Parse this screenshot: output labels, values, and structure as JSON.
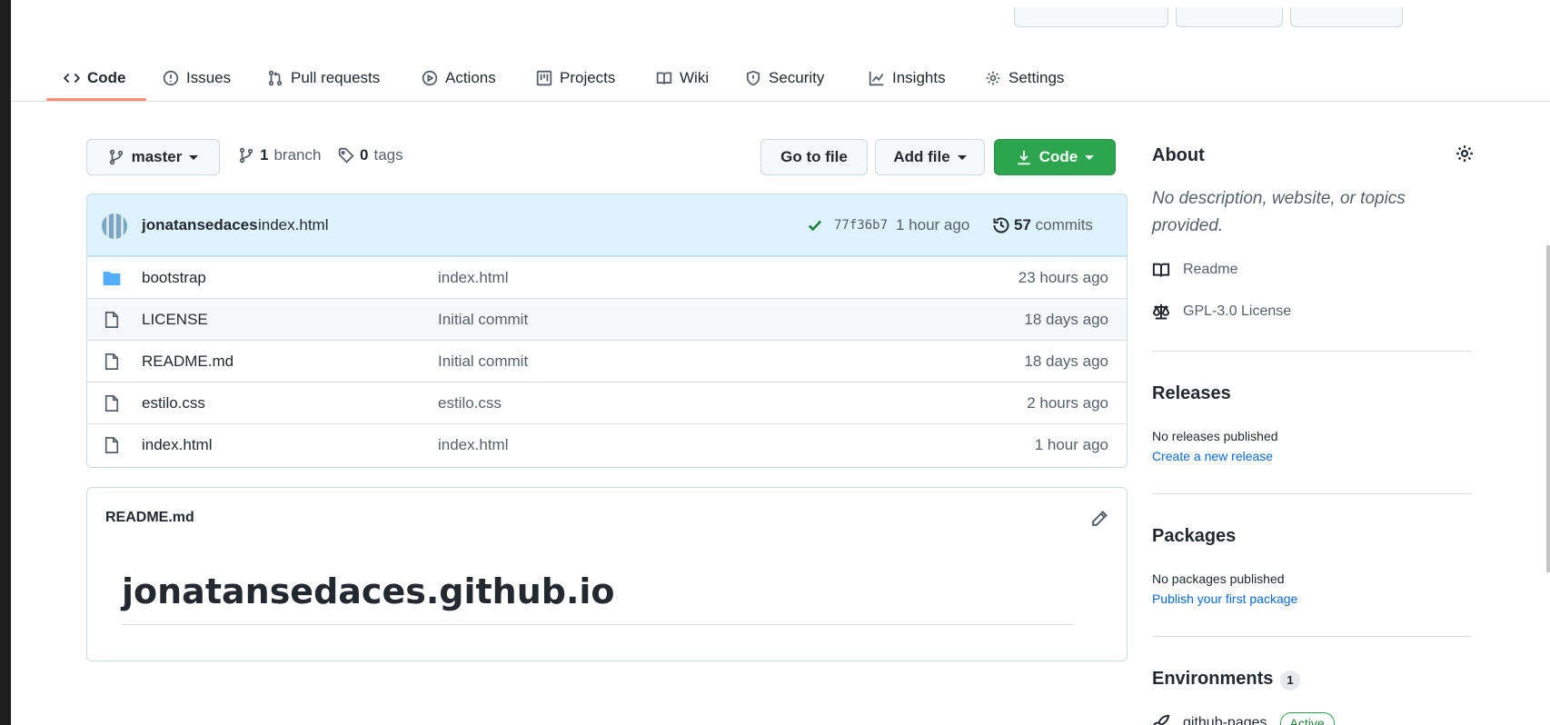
{
  "nav": {
    "tabs": [
      {
        "label": "Code",
        "icon": "code-icon"
      },
      {
        "label": "Issues",
        "icon": "issue-icon"
      },
      {
        "label": "Pull requests",
        "icon": "pull-request-icon"
      },
      {
        "label": "Actions",
        "icon": "play-icon"
      },
      {
        "label": "Projects",
        "icon": "project-icon"
      },
      {
        "label": "Wiki",
        "icon": "book-icon"
      },
      {
        "label": "Security",
        "icon": "shield-icon"
      },
      {
        "label": "Insights",
        "icon": "graph-icon"
      },
      {
        "label": "Settings",
        "icon": "gear-icon"
      }
    ],
    "active_tab": "Code"
  },
  "branch_bar": {
    "branch_name": "master",
    "branches_count": "1",
    "branches_label": "branch",
    "tags_count": "0",
    "tags_label": "tags",
    "go_to_file": "Go to file",
    "add_file": "Add file",
    "code_button": "Code"
  },
  "commit": {
    "author": "jonatansedaces",
    "message": "index.html",
    "sha": "77f36b7",
    "time": "1 hour ago",
    "commits_count": "57",
    "commits_label": "commits"
  },
  "files": [
    {
      "name": "bootstrap",
      "type": "folder",
      "message": "index.html",
      "age": "23 hours ago"
    },
    {
      "name": "LICENSE",
      "type": "file",
      "message": "Initial commit",
      "age": "18 days ago"
    },
    {
      "name": "README.md",
      "type": "file",
      "message": "Initial commit",
      "age": "18 days ago"
    },
    {
      "name": "estilo.css",
      "type": "file",
      "message": "estilo.css",
      "age": "2 hours ago"
    },
    {
      "name": "index.html",
      "type": "file",
      "message": "index.html",
      "age": "1 hour ago"
    }
  ],
  "readme": {
    "filename": "README.md",
    "heading": "jonatansedaces.github.io"
  },
  "sidebar": {
    "about": {
      "title": "About",
      "description": "No description, website, or topics provided.",
      "readme_label": "Readme",
      "license_label": "GPL-3.0 License"
    },
    "releases": {
      "title": "Releases",
      "status": "No releases published",
      "link": "Create a new release"
    },
    "packages": {
      "title": "Packages",
      "status": "No packages published",
      "link": "Publish your first package"
    },
    "environments": {
      "title": "Environments",
      "count": "1",
      "env_name": "github-pages",
      "env_status": "Active"
    }
  },
  "colors": {
    "accent_green": "#2da44e",
    "link_blue": "#0969da",
    "tab_underline": "#fd8c73",
    "commit_bar": "#ddf4ff"
  }
}
